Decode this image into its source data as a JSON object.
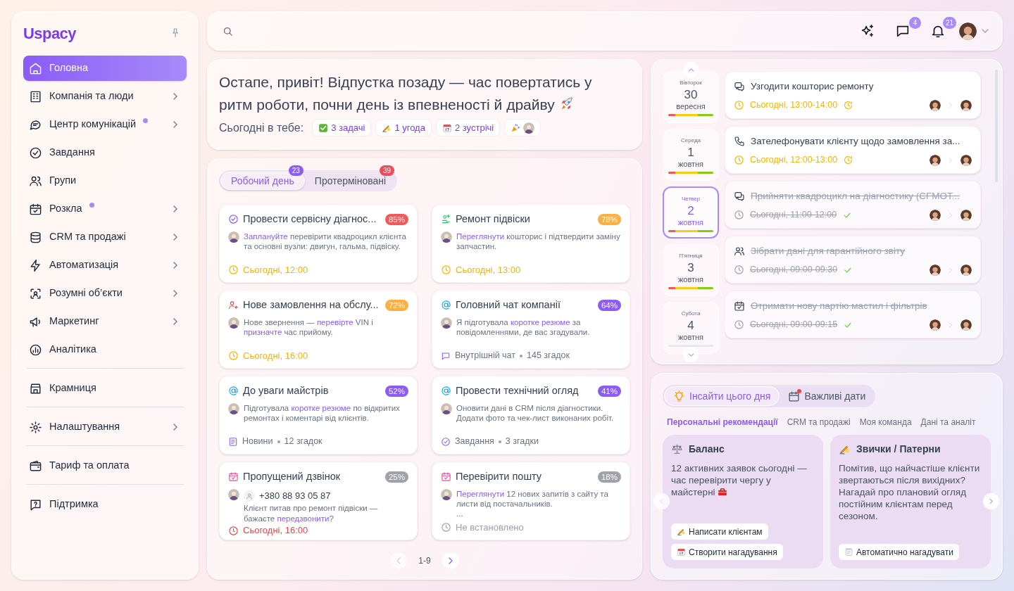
{
  "logo": {
    "text": "Uspacy"
  },
  "sidebar": {
    "groups": [
      [
        {
          "label": "Головна",
          "kind": "home",
          "selected": true,
          "has_submenu": false,
          "dot": false
        },
        {
          "label": "Компанія та люди",
          "kind": "company",
          "selected": false,
          "has_submenu": true,
          "dot": false
        },
        {
          "label": "Центр комунікацій",
          "kind": "communications",
          "selected": false,
          "has_submenu": true,
          "dot": true
        },
        {
          "label": "Завдання",
          "kind": "tasks",
          "selected": false,
          "has_submenu": false,
          "dot": false
        },
        {
          "label": "Групи",
          "kind": "groups",
          "selected": false,
          "has_submenu": false,
          "dot": false
        },
        {
          "label": "Розкла",
          "kind": "schedule",
          "selected": false,
          "has_submenu": true,
          "dot": true
        },
        {
          "label": "CRM та продажі",
          "kind": "crm",
          "selected": false,
          "has_submenu": true,
          "dot": false
        },
        {
          "label": "Автоматизація",
          "kind": "automation",
          "selected": false,
          "has_submenu": true,
          "dot": false
        },
        {
          "label": "Розумні об’єкти",
          "kind": "objects",
          "selected": false,
          "has_submenu": true,
          "dot": false
        },
        {
          "label": "Маркетинг",
          "kind": "marketing",
          "selected": false,
          "has_submenu": true,
          "dot": false
        },
        {
          "label": "Аналітика",
          "kind": "analytics",
          "selected": false,
          "has_submenu": false,
          "dot": false
        }
      ],
      [
        {
          "label": "Крамниця",
          "kind": "store",
          "selected": false,
          "has_submenu": false,
          "dot": false
        }
      ],
      [
        {
          "label": "Налаштування",
          "kind": "settings",
          "selected": false,
          "has_submenu": true,
          "dot": false
        }
      ],
      [
        {
          "label": "Тариф та оплата",
          "kind": "billing",
          "selected": false,
          "has_submenu": false,
          "dot": false
        }
      ],
      [
        {
          "label": "Підтримка",
          "kind": "support",
          "selected": false,
          "has_submenu": false,
          "dot": false
        }
      ]
    ]
  },
  "topbar": {
    "actions": [
      {
        "kind": "assistant"
      },
      {
        "kind": "messages",
        "badge": "4"
      },
      {
        "kind": "notifications",
        "badge": "21"
      }
    ]
  },
  "greeting": {
    "text": "Остапе, привіт! Відпустка позаду — час повертатись у ритм роботи, почни день із впевненості й драйву",
    "summary_label": "Сьогодні в тебе:",
    "chips": [
      {
        "kind": "tasks",
        "text": "3 задачі"
      },
      {
        "kind": "deals",
        "text": "1 угода"
      },
      {
        "kind": "meetings",
        "text": "2 зустрічі"
      },
      {
        "kind": "celebration"
      }
    ]
  },
  "tasks": {
    "tabs": [
      {
        "label": "Робочий день",
        "count": "23",
        "color": "#8b5cf6",
        "selected": true
      },
      {
        "label": "Протерміновані",
        "count": "39",
        "color": "#f04b5a",
        "selected": false
      }
    ],
    "cards": [
      {
        "kind": "task",
        "title": "Провести сервісну діагнос...",
        "percent": "85%",
        "color": "#f05a5a",
        "description": [
          {
            "text": "Заплануйте",
            "link": true
          },
          {
            "text": " перевірити квадроцикл клієнта та основні вузли: двигун, гальма, підвіску.",
            "link": false
          }
        ],
        "footer": {
          "kind": "due",
          "text": "Сьогодні, 12:00"
        }
      },
      {
        "kind": "repair",
        "title": "Ремонт підвіски",
        "percent": "78%",
        "color": "#fbb040",
        "description": [
          {
            "text": "Переглянути",
            "link": true
          },
          {
            "text": " кошторис і підтвердити заміну запчастин.",
            "link": false
          }
        ],
        "footer": {
          "kind": "due",
          "text": "Сьогодні, 13:00"
        }
      },
      {
        "kind": "order",
        "title": "Нове замовлення на обслу...",
        "percent": "72%",
        "color": "#fbb040",
        "description": [
          {
            "text": "Нове звернення — ",
            "link": false
          },
          {
            "text": "перевірте",
            "link": true
          },
          {
            "text": " VIN і ",
            "link": false
          },
          {
            "text": "призначте",
            "link": true
          },
          {
            "text": " час прийому.",
            "link": false
          }
        ],
        "footer": {
          "kind": "due",
          "text": "Сьогодні, 16:00"
        }
      },
      {
        "kind": "mention",
        "title": "Головний чат компанії",
        "percent": "64%",
        "color": "#8b5cf6",
        "description": [
          {
            "text": "Я підготувала ",
            "link": false
          },
          {
            "text": "коротке резюме",
            "link": true
          },
          {
            "text": " за повідомленнями, де вас згадували.",
            "link": false
          }
        ],
        "footer": {
          "kind": "chat",
          "text": "Внутрішній чат",
          "count": "145 згадок"
        }
      },
      {
        "kind": "mention",
        "title": "До уваги майстрів",
        "percent": "52%",
        "color": "#8b5cf6",
        "description": [
          {
            "text": "Підготувала ",
            "link": false
          },
          {
            "text": "коротке резюме",
            "link": true
          },
          {
            "text": " по відкритих ремонтах і коментарі від клієнтів.",
            "link": false
          }
        ],
        "footer": {
          "kind": "news",
          "text": "Новини",
          "count": "12 згадок"
        }
      },
      {
        "kind": "mention",
        "title": "Провести технічний огляд",
        "percent": "41%",
        "color": "#8b5cf6",
        "description": [
          {
            "text": "Оновити дані в CRM після діагностики. Додати фото та чек-лист виконаних робіт.",
            "link": false
          }
        ],
        "footer": {
          "kind": "task",
          "text": "Завдання",
          "count": "3 згадки"
        }
      },
      {
        "kind": "event",
        "title": "Пропущений дзвінок",
        "percent": "25%",
        "color": "#a1a1aa",
        "phone": "+380 88 93 05 87",
        "description": [
          {
            "text": "Клієнт питав про ремонт підвіски — бажаєте ",
            "link": false
          },
          {
            "text": "передзвонити",
            "link": true
          },
          {
            "text": "?",
            "link": false
          }
        ],
        "footer": {
          "kind": "overdue",
          "text": "Сьогодні, 16:00"
        }
      },
      {
        "kind": "event",
        "title": "Перевірити пошту",
        "percent": "18%",
        "color": "#a1a1aa",
        "description": [
          {
            "text": "Переглянути",
            "link": true
          },
          {
            "text": " 12 нових запитів з сайту та листи від постачальників.",
            "link": false
          }
        ],
        "more": "...",
        "footer": {
          "kind": "unset",
          "text": "Не встановлено"
        }
      }
    ],
    "pagination": {
      "range": "1-9"
    }
  },
  "calendar": {
    "days": [
      {
        "weekday": "Вівторок",
        "day": "30",
        "month": "вересня",
        "selected": false,
        "load": true
      },
      {
        "weekday": "Середа",
        "day": "1",
        "month": "жовтня",
        "selected": false,
        "load": true
      },
      {
        "weekday": "Четвер",
        "day": "2",
        "month": "жовтня",
        "selected": true,
        "load": true
      },
      {
        "weekday": "П’ятниця",
        "day": "3",
        "month": "жовтня",
        "selected": false,
        "load": true
      },
      {
        "weekday": "Субота",
        "day": "4",
        "month": "жовтня",
        "selected": false,
        "load": false
      }
    ],
    "events": [
      {
        "kind": "meeting",
        "title": "Узгодити кошторис ремонту",
        "time": "Сьогодні, 13:00-14:00",
        "done": false
      },
      {
        "kind": "call",
        "title": "Зателефонувати клієнту щодо замовлення за...",
        "time": "Сьогодні, 12:00-13:00",
        "done": false
      },
      {
        "kind": "meeting",
        "title": "Прийняти квадроцикл на діагностику (CFMOT...",
        "time": "Сьогодні, 11:00-12:00",
        "done": true
      },
      {
        "kind": "team",
        "title": "Зібрати дані для гарантійного звіту",
        "time": "Сьогодні, 09:00-09:30",
        "done": true
      },
      {
        "kind": "task",
        "title": "Отримати нову партію мастил і фільтрів",
        "time": "Сьогодні, 09:00-09:15",
        "done": true
      }
    ]
  },
  "insights": {
    "tabs": [
      {
        "label": "Інсайти цього дня",
        "kind": "insights",
        "selected": true,
        "dot": false
      },
      {
        "label": "Важливі дати",
        "kind": "dates",
        "selected": false,
        "dot": true
      }
    ],
    "categories": [
      {
        "label": "Персональні рекомендації",
        "selected": true
      },
      {
        "label": "CRM та продажі",
        "selected": false
      },
      {
        "label": "Моя команда",
        "selected": false
      },
      {
        "label": "Дані та аналіт",
        "selected": false
      }
    ],
    "cards": [
      {
        "kind": "balance",
        "title": "Баланс",
        "text": "12 активних заявок сьогодні — час перевірити чергу у майстерні",
        "actions": [
          {
            "kind": "write",
            "label": "Написати клієнтам"
          },
          {
            "kind": "reminder",
            "label": "Створити нагадування"
          }
        ]
      },
      {
        "kind": "habits",
        "title": "Звички / Патерни",
        "text": "Помітив, що найчастіше клієнти звертаються після вихідних? Нагадай про плановий огляд постійним клієнтам перед сезоном.",
        "actions": [
          {
            "kind": "auto",
            "label": "Автоматично нагадувати"
          }
        ]
      }
    ]
  }
}
